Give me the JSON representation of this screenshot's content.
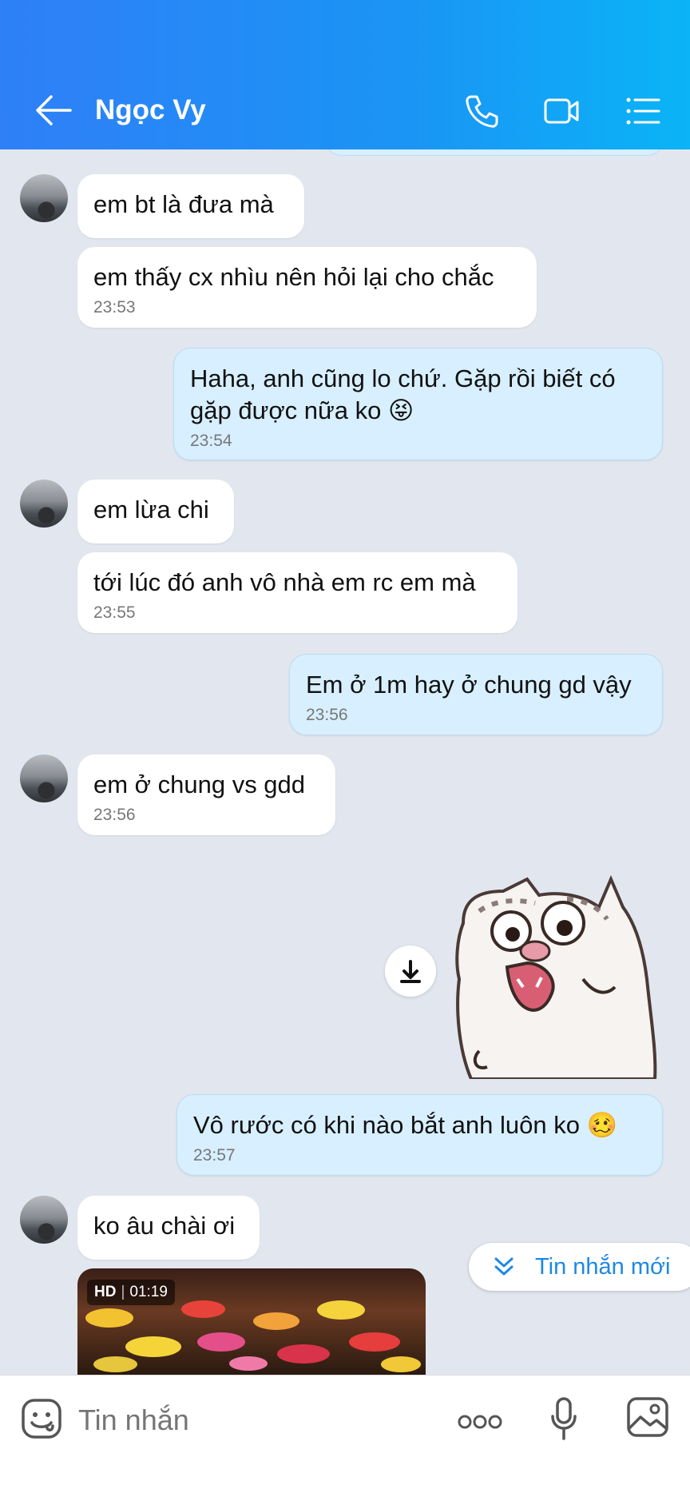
{
  "header": {
    "title": "Ngọc Vy",
    "icons": [
      "back-arrow-icon",
      "phone-icon",
      "video-call-icon",
      "menu-list-icon"
    ],
    "gradient": [
      "#2f7ff6",
      "#0ab4f6"
    ]
  },
  "messages": [
    {
      "side": "them",
      "text": "em bt là đưa mà",
      "time": ""
    },
    {
      "side": "them",
      "text": "em thấy cx nhìu nên hỏi lại cho chắc",
      "time": "23:53"
    },
    {
      "side": "me",
      "lines": [
        "Haha, anh cũng lo chứ. Gặp rồi biết có",
        "gặp được nữa ko 😝"
      ],
      "time": "23:54"
    },
    {
      "side": "them",
      "text": "em lừa chi",
      "time": ""
    },
    {
      "side": "them",
      "text": "tới lúc đó anh vô nhà em rc em mà",
      "time": "23:55"
    },
    {
      "side": "me",
      "text": "Em ở 1m hay ở chung gd vậy",
      "time": "23:56"
    },
    {
      "side": "them",
      "text": "em ở chung vs gdd",
      "time": "23:56"
    },
    {
      "side": "me",
      "text": "Vô rước có khi nào bắt anh luôn ko 🥴",
      "time": "23:57"
    },
    {
      "side": "them",
      "text": "ko âu chài ơi",
      "time": ""
    }
  ],
  "video": {
    "quality": "HD",
    "duration": "01:19"
  },
  "new_message_button": {
    "label": "Tin nhắn mới"
  },
  "composer": {
    "placeholder": "Tin nhắn"
  },
  "colors": {
    "my_bubble": "#d7efff",
    "their_bubble": "#ffffff",
    "background": "#e2e7ef",
    "accent": "#1e88e5"
  }
}
